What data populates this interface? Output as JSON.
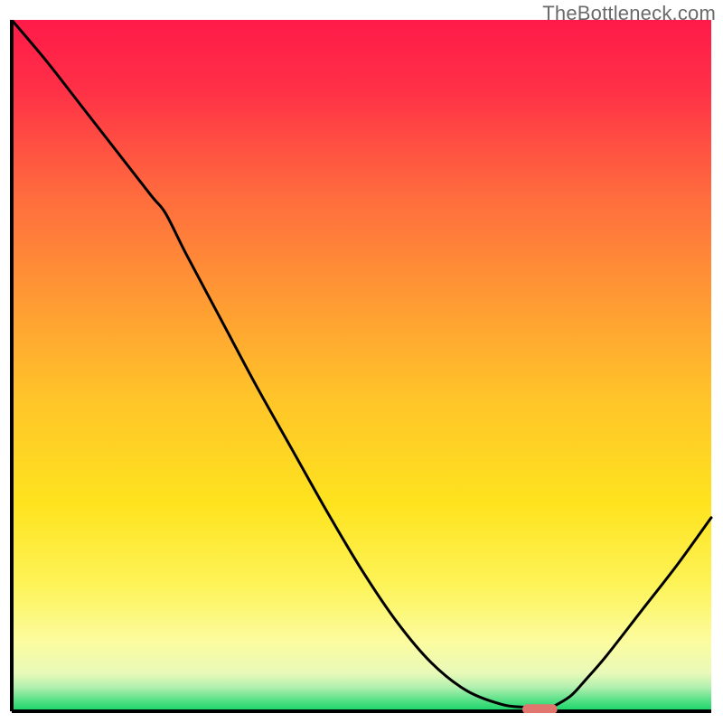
{
  "watermark": "TheBottleneck.com",
  "chart_data": {
    "type": "line",
    "title": "",
    "xlabel": "",
    "ylabel": "",
    "xlim": [
      0,
      100
    ],
    "ylim": [
      0,
      100
    ],
    "grid": false,
    "axes_visible": false,
    "series": [
      {
        "name": "curve",
        "x": [
          0,
          5,
          10,
          15,
          20,
          22,
          25,
          30,
          35,
          40,
          45,
          50,
          55,
          60,
          65,
          70,
          73,
          75,
          77,
          78,
          80,
          82,
          85,
          90,
          95,
          100
        ],
        "y": [
          100,
          94,
          87.5,
          81,
          74.5,
          72,
          66,
          56.5,
          47,
          38,
          29,
          20.5,
          13,
          7,
          3,
          1,
          0.6,
          0.6,
          0.6,
          1,
          2.3,
          4.5,
          8,
          14.5,
          21,
          28
        ]
      }
    ],
    "marker": {
      "name": "optimal-range",
      "x_start": 73,
      "x_end": 78,
      "y": 0.3,
      "color": "#e0766d"
    },
    "gradient_stops": [
      {
        "offset": 0.0,
        "color": "#ff1a49"
      },
      {
        "offset": 0.1,
        "color": "#ff3047"
      },
      {
        "offset": 0.25,
        "color": "#ff6a3e"
      },
      {
        "offset": 0.4,
        "color": "#ff9934"
      },
      {
        "offset": 0.55,
        "color": "#ffc529"
      },
      {
        "offset": 0.7,
        "color": "#fee31e"
      },
      {
        "offset": 0.82,
        "color": "#fdf45a"
      },
      {
        "offset": 0.9,
        "color": "#fcfca0"
      },
      {
        "offset": 0.945,
        "color": "#e8f9b8"
      },
      {
        "offset": 0.965,
        "color": "#b3f0b0"
      },
      {
        "offset": 0.985,
        "color": "#52e085"
      },
      {
        "offset": 1.0,
        "color": "#17d368"
      }
    ],
    "curve_stroke": "#000000",
    "curve_width": 3,
    "axis_stroke": "#000000",
    "axis_width": 4
  }
}
